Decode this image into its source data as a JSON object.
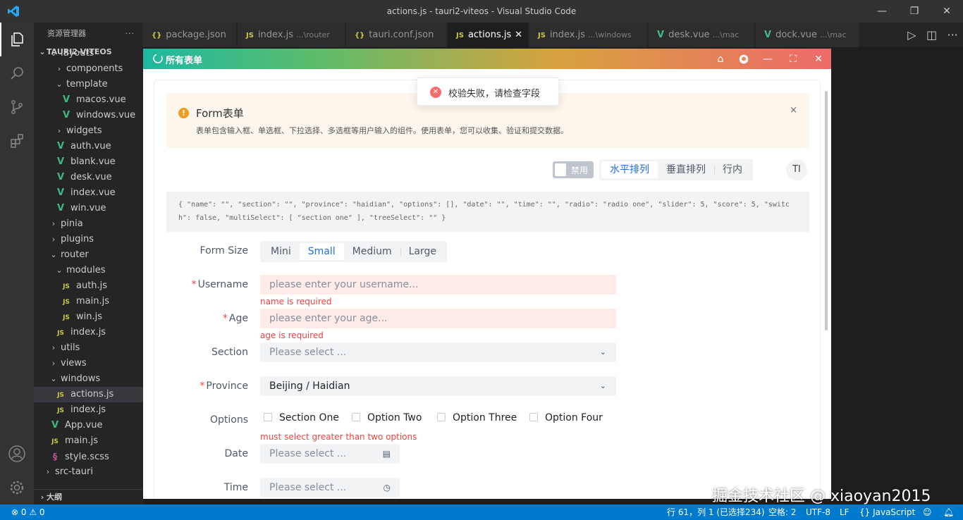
{
  "window": {
    "title": "actions.js - tauri2-viteos - Visual Studio Code"
  },
  "sidebar": {
    "header": "资源管理器",
    "more": "···",
    "project": "TAURI2-VITEOS",
    "tree": [
      {
        "label": "layouts",
        "type": "folder-open",
        "indent": 1
      },
      {
        "label": "components",
        "type": "folder",
        "indent": 2
      },
      {
        "label": "template",
        "type": "folder-open",
        "indent": 2
      },
      {
        "label": "macos.vue",
        "type": "vue",
        "indent": 3
      },
      {
        "label": "windows.vue",
        "type": "vue",
        "indent": 3
      },
      {
        "label": "widgets",
        "type": "folder",
        "indent": 2
      },
      {
        "label": "auth.vue",
        "type": "vue",
        "indent": 2
      },
      {
        "label": "blank.vue",
        "type": "vue",
        "indent": 2
      },
      {
        "label": "desk.vue",
        "type": "vue",
        "indent": 2
      },
      {
        "label": "index.vue",
        "type": "vue",
        "indent": 2
      },
      {
        "label": "win.vue",
        "type": "vue",
        "indent": 2
      },
      {
        "label": "pinia",
        "type": "folder",
        "indent": 1
      },
      {
        "label": "plugins",
        "type": "folder",
        "indent": 1
      },
      {
        "label": "router",
        "type": "folder-open",
        "indent": 1
      },
      {
        "label": "modules",
        "type": "folder-open",
        "indent": 2
      },
      {
        "label": "auth.js",
        "type": "js",
        "indent": 3
      },
      {
        "label": "main.js",
        "type": "js",
        "indent": 3
      },
      {
        "label": "win.js",
        "type": "js",
        "indent": 3
      },
      {
        "label": "index.js",
        "type": "js",
        "indent": 2
      },
      {
        "label": "utils",
        "type": "folder",
        "indent": 1
      },
      {
        "label": "views",
        "type": "folder",
        "indent": 1
      },
      {
        "label": "windows",
        "type": "folder-open",
        "indent": 1
      },
      {
        "label": "actions.js",
        "type": "js",
        "indent": 2,
        "selected": true
      },
      {
        "label": "index.js",
        "type": "js",
        "indent": 2
      },
      {
        "label": "App.vue",
        "type": "vue",
        "indent": 1
      },
      {
        "label": "main.js",
        "type": "js",
        "indent": 1
      },
      {
        "label": "style.scss",
        "type": "scss",
        "indent": 1
      },
      {
        "label": "src-tauri",
        "type": "folder",
        "indent": 0
      }
    ],
    "outline": "大纲"
  },
  "tabs": [
    {
      "label": "package.json",
      "icon": "{}",
      "icon_type": "json",
      "sub": ""
    },
    {
      "label": "index.js",
      "icon": "JS",
      "icon_type": "js",
      "sub": "...\\router"
    },
    {
      "label": "tauri.conf.json",
      "icon": "{}",
      "icon_type": "json",
      "sub": ""
    },
    {
      "label": "actions.js",
      "icon": "JS",
      "icon_type": "js",
      "sub": "",
      "active": true
    },
    {
      "label": "index.js",
      "icon": "JS",
      "icon_type": "js",
      "sub": "...\\windows"
    },
    {
      "label": "desk.vue",
      "icon": "V",
      "icon_type": "vue",
      "sub": "...\\mac"
    },
    {
      "label": "dock.vue",
      "icon": "V",
      "icon_type": "vue",
      "sub": "...\\mac"
    }
  ],
  "app": {
    "title": "所有表单",
    "toast": "校验失败，请检查字段",
    "alert": {
      "title": "Form表单",
      "desc": "表单包含输入框、单选框、下拉选择、多选框等用户输入的组件。使用表单，您可以收集、验证和提交数据。",
      "close": "×"
    },
    "disable_switch": "禁用",
    "layout_options": [
      "水平排列",
      "垂直排列",
      "行内"
    ],
    "font_button": "TI",
    "json_preview": "{ \"name\": \"\", \"section\": \"\", \"province\": \"haidian\", \"options\": [], \"date\": \"\", \"time\": \"\", \"radio\": \"radio one\", \"slider\": 5, \"score\": 5, \"switch\": false, \"multiSelect\": [ \"section one\" ], \"treeSelect\": \"\" }",
    "form": {
      "size_label": "Form Size",
      "sizes": [
        "Mini",
        "Small",
        "Medium",
        "Large"
      ],
      "username_label": "Username",
      "username_placeholder": "please enter your username...",
      "username_error": "name is required",
      "age_label": "Age",
      "age_placeholder": "please enter your age...",
      "age_error": "age is required",
      "section_label": "Section",
      "section_placeholder": "Please select ...",
      "province_label": "Province",
      "province_value": "Beijing / Haidian",
      "options_label": "Options",
      "options": [
        "Section One",
        "Option Two",
        "Option Three",
        "Option Four"
      ],
      "options_error": "must select greater than two options",
      "date_label": "Date",
      "date_placeholder": "Please select ...",
      "time_label": "Time",
      "time_placeholder": "Please select ..."
    }
  },
  "statusbar": {
    "errors": "⊗ 0 ⚠ 0",
    "position": "行 61，列 1 (已选择234)",
    "spaces": "空格: 2",
    "encoding": "UTF-8",
    "eol": "LF",
    "language": "{} JavaScript"
  },
  "watermark": "掘金技术社区 @ xiaoyan2015"
}
